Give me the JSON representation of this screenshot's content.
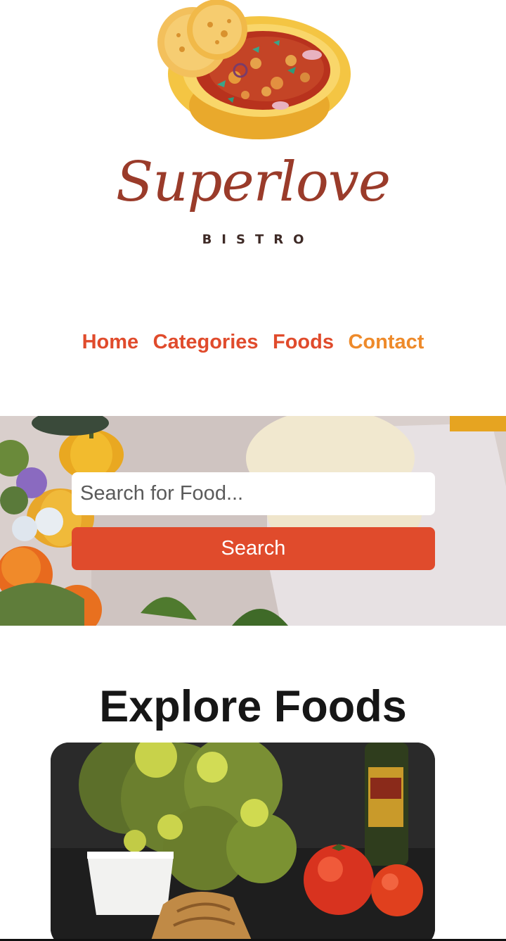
{
  "logo": {
    "script": "Superlove",
    "subtitle": "BISTRO"
  },
  "nav": {
    "items": [
      {
        "label": "Home"
      },
      {
        "label": "Categories"
      },
      {
        "label": "Foods"
      },
      {
        "label": "Contact"
      }
    ],
    "active_index": 3
  },
  "search": {
    "placeholder": "Search for Food...",
    "value": "",
    "button_label": "Search"
  },
  "explore": {
    "title": "Explore Foods"
  },
  "colors": {
    "accent": "#e04b2c",
    "accent_active": "#ee8a2a",
    "logo_brown": "#9a3b2a"
  },
  "icons": [
    "logo-bowl-illustration",
    "hero-food-background",
    "food-card-image"
  ]
}
